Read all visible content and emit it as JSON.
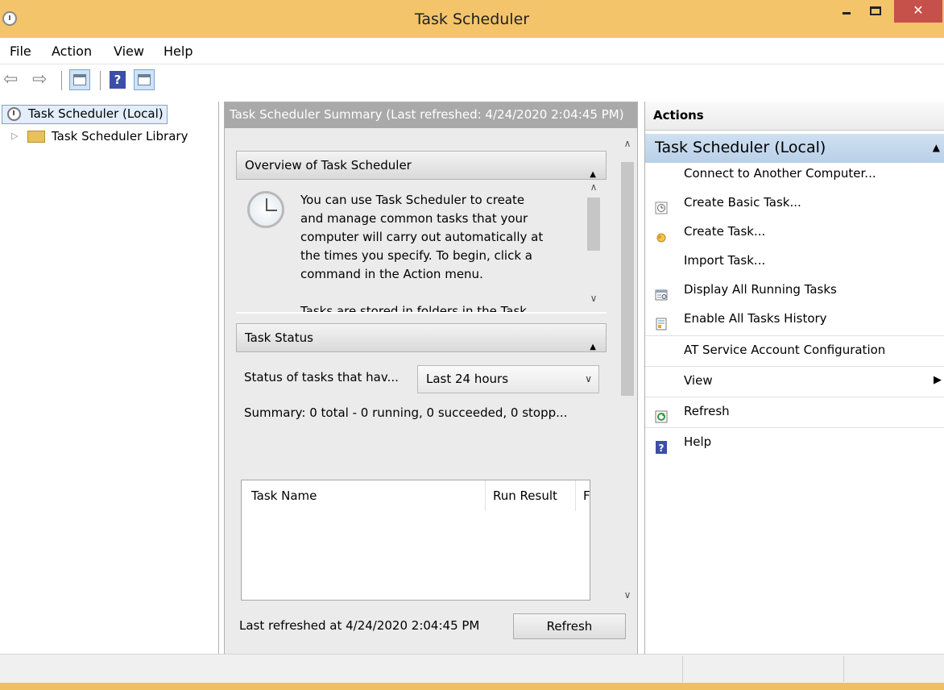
{
  "window": {
    "title": "Task Scheduler",
    "close_glyph": "✕"
  },
  "menu": [
    "File",
    "Action",
    "View",
    "Help"
  ],
  "toolbar": {
    "back_glyph": "⇦",
    "forward_glyph": "⇨",
    "help_glyph": "?"
  },
  "tree": {
    "root": "Task Scheduler (Local)",
    "children": [
      "Task Scheduler Library"
    ],
    "expander_glyph": "▷"
  },
  "center": {
    "header": "Task Scheduler Summary (Last refreshed: 4/24/2020 2:04:45 PM)",
    "overview": {
      "title": "Overview of Task Scheduler",
      "lines": [
        "You can use Task Scheduler to create",
        "and manage common tasks that your",
        "computer will carry out automatically at",
        "the times you specify. To begin, click a",
        "command in the Action menu.",
        "",
        "Tasks are stored in folders in the Task"
      ]
    },
    "task_status": {
      "title": "Task Status",
      "filter_label": "Status of tasks that hav...",
      "filter_value": "Last 24 hours",
      "summary": "Summary: 0 total - 0 running, 0 succeeded, 0 stopp...",
      "columns": [
        "Task Name",
        "Run Result",
        "F"
      ]
    },
    "footer": {
      "last_refreshed": "Last refreshed at 4/24/2020 2:04:45 PM",
      "refresh_button": "Refresh"
    }
  },
  "actions": {
    "header": "Actions",
    "group": "Task Scheduler (Local)",
    "items": [
      {
        "label": "Connect to Another Computer...",
        "icon": "none"
      },
      {
        "label": "Create Basic Task...",
        "icon": "basic-task-icon"
      },
      {
        "label": "Create Task...",
        "icon": "create-task-icon"
      },
      {
        "label": "Import Task...",
        "icon": "none"
      },
      {
        "label": "Display All Running Tasks",
        "icon": "running-tasks-icon"
      },
      {
        "label": "Enable All Tasks History",
        "icon": "history-icon"
      },
      {
        "label": "AT Service Account Configuration",
        "icon": "none"
      },
      {
        "label": "View",
        "icon": "none",
        "submenu": true
      },
      {
        "label": "Refresh",
        "icon": "refresh-icon"
      },
      {
        "label": "Help",
        "icon": "help-icon"
      }
    ]
  },
  "colors": {
    "titlebar": "#f3c46a",
    "close_button": "#c6504a",
    "actions_group": "#c5d9ee",
    "center_header": "#a9a9a9"
  }
}
